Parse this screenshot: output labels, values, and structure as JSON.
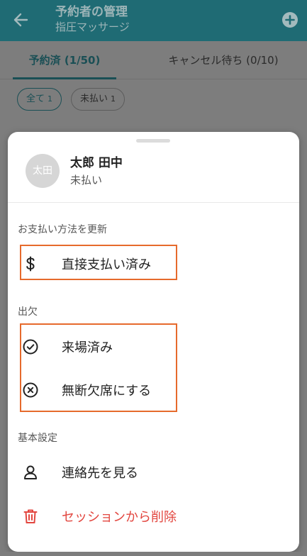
{
  "header": {
    "title": "予約者の管理",
    "subtitle": "指圧マッサージ"
  },
  "tabs": [
    {
      "label": "予約済 (1/50)",
      "active": true
    },
    {
      "label": "キャンセル待ち (0/10)",
      "active": false
    }
  ],
  "filters": [
    {
      "label": "全て",
      "count": "1",
      "active": true
    },
    {
      "label": "未払い",
      "count": "1",
      "active": false
    }
  ],
  "sheet": {
    "user": {
      "avatar_text": "太田",
      "name": "太郎 田中",
      "status": "未払い"
    },
    "sections": {
      "payment": "お支払い方法を更新",
      "attendance": "出欠",
      "basic": "基本設定"
    },
    "items": {
      "direct_payment": {
        "label": "直接支払い済み",
        "icon": "dollar-icon"
      },
      "attended": {
        "label": "来場済み",
        "icon": "check-circle-icon"
      },
      "no_show": {
        "label": "無断欠席にする",
        "icon": "x-circle-icon"
      },
      "view_contact": {
        "label": "連絡先を見る",
        "icon": "person-icon"
      },
      "remove": {
        "label": "セッションから削除",
        "icon": "trash-icon"
      }
    }
  },
  "colors": {
    "app_bar": "#1f6b74",
    "highlight": "#e66a2c",
    "danger": "#e2463f",
    "overlay": "#7d7d7d"
  }
}
